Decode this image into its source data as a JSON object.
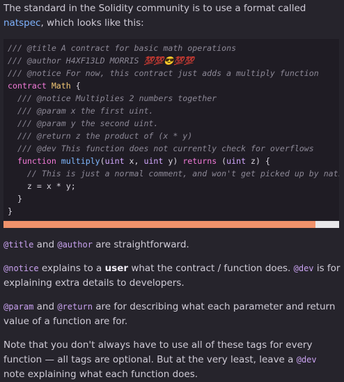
{
  "intro": {
    "before": "The standard in the Solidity community is to use a format called ",
    "link": "natspec",
    "after": ", which looks like this:"
  },
  "code_lines": [
    "/// @title A contract for basic math operations",
    "/// @author H4XF13LD MORRIS 💯💯😎💯💯",
    "/// @notice For now, this contract just adds a multiply function",
    "contract Math {",
    "  /// @notice Multiplies 2 numbers together",
    "  /// @param x the first uint.",
    "  /// @param y the second uint.",
    "  /// @return z the product of (x * y)",
    "  /// @dev This function does not currently check for overflows",
    "  function multiply(uint x, uint y) returns (uint z) {",
    "    // This is just a normal comment, and won't get picked up by natspec",
    "    z = x * y;",
    "  }",
    "}"
  ],
  "code_scroll": {
    "visible_fraction": 0.93
  },
  "para2": {
    "tag1": "@title",
    "mid": " and ",
    "tag2": "@author",
    "rest": " are straightforward."
  },
  "para3": {
    "tag1": "@notice",
    "a": " explains to a ",
    "strong": "user",
    "b": " what the contract / function does. ",
    "tag2": "@dev",
    "c": " is for explaining extra details to developers."
  },
  "para4": {
    "tag1": "@param",
    "mid": " and ",
    "tag2": "@return",
    "rest": " are for describing what each parameter and return value of a function are for."
  },
  "para5": {
    "a": "Note that you don't always have to use all of these tags for every function — all tags are optional. But at the very least, leave a ",
    "tag": "@dev",
    "b": " note explaining what each function does."
  },
  "colors": {
    "background": "#26242c",
    "code_background": "#1f1c24",
    "scroll_thumb": "#f0926b",
    "tag": "#c9a2f0",
    "link": "#7fb3ff"
  }
}
